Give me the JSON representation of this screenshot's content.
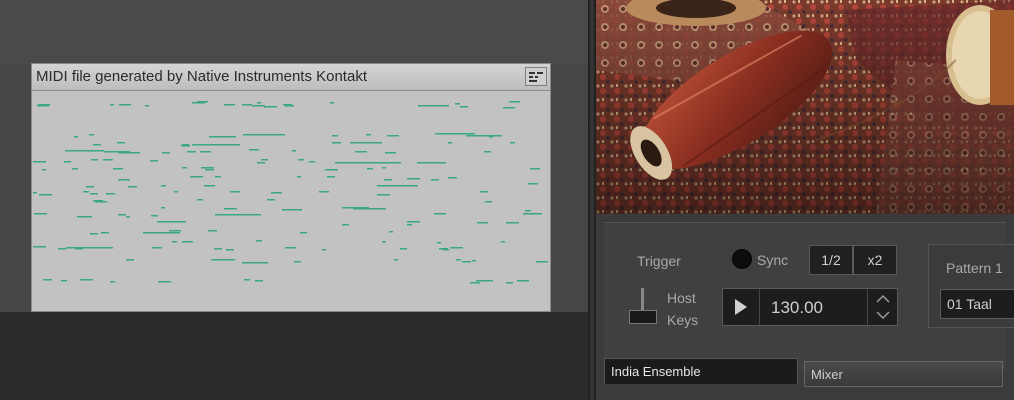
{
  "midi_window": {
    "title": "MIDI file generated by Native Instruments Kontakt",
    "menu_icon": "pattern-menu-icon",
    "note_color": "#3aa883"
  },
  "instrument": {
    "trigger_label": "Trigger",
    "sync_label": "Sync",
    "half_label": "1/2",
    "double_label": "x2",
    "host_label": "Host",
    "keys_label": "Keys",
    "tempo": "130.00",
    "pattern_label": "Pattern 1",
    "pattern_value": "01 Taal"
  },
  "tabs": {
    "active": "India Ensemble",
    "inactive": "Mixer"
  }
}
